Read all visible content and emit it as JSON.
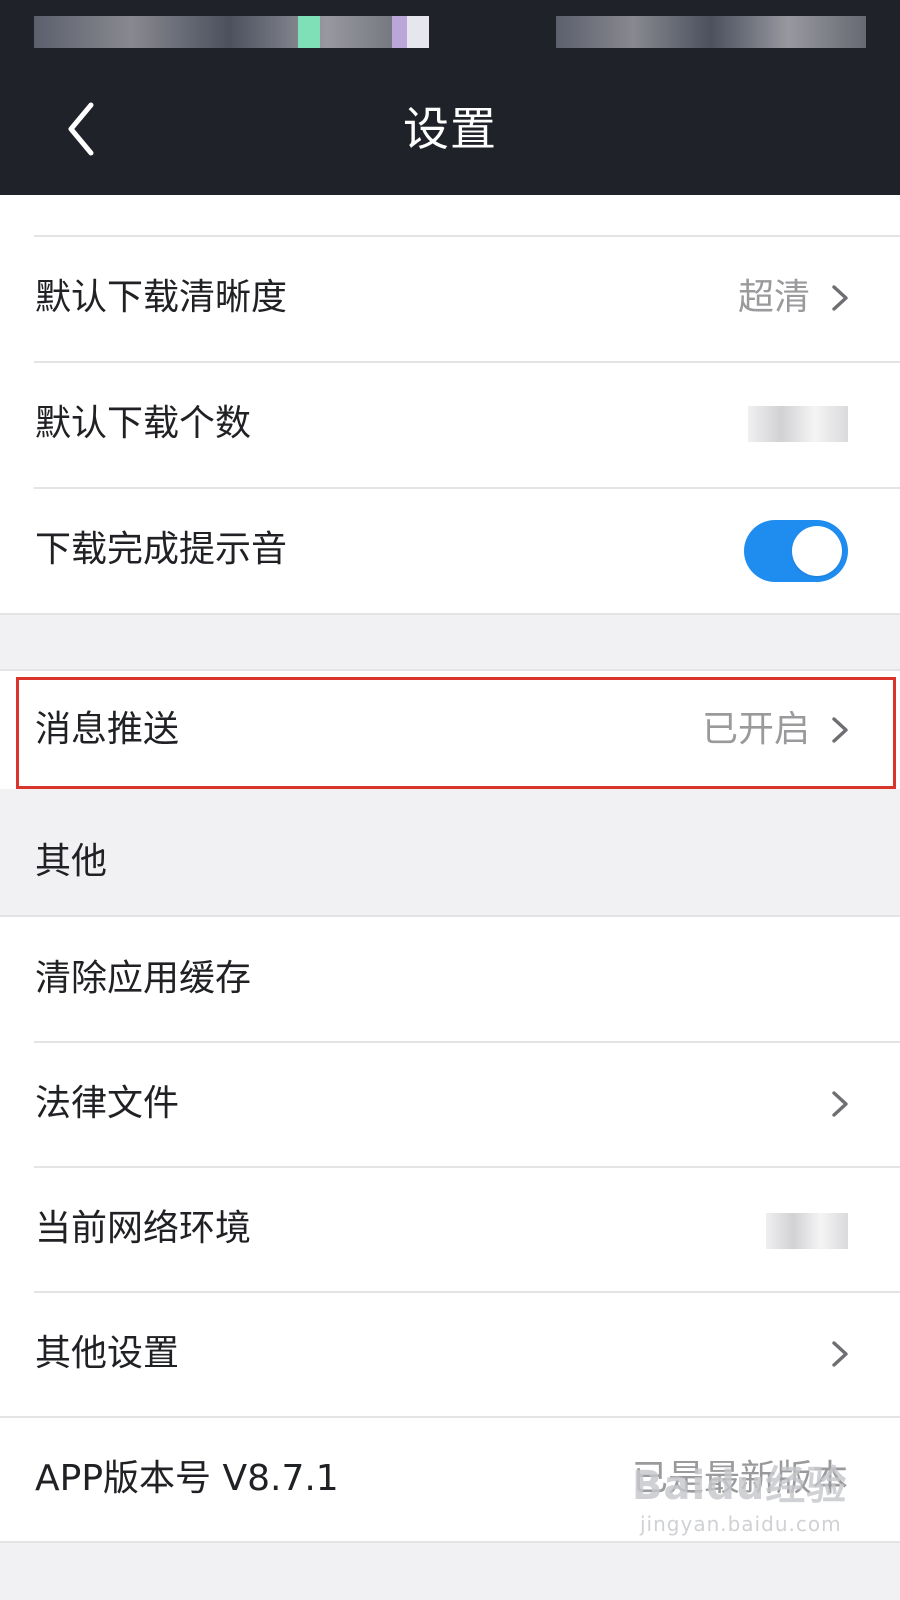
{
  "header": {
    "title": "设置"
  },
  "settings": {
    "download_quality": {
      "label": "默认下载清晰度",
      "value": "超清"
    },
    "download_count": {
      "label": "默认下载个数"
    },
    "download_sound": {
      "label": "下载完成提示音",
      "enabled": true
    },
    "push": {
      "label": "消息推送",
      "value": "已开启"
    }
  },
  "other": {
    "section_title": "其他",
    "clear_cache": {
      "label": "清除应用缓存"
    },
    "legal": {
      "label": "法律文件"
    },
    "network": {
      "label": "当前网络环境"
    },
    "other_settings": {
      "label": "其他设置"
    },
    "version": {
      "label": "APP版本号 V8.7.1",
      "value": "已是最新版本"
    }
  },
  "watermark": {
    "brand": "Baidu经验",
    "url": "jingyan.baidu.com"
  },
  "colors": {
    "header_background": "#1f2229",
    "toggle_on": "#1f8df0",
    "highlight": "#d9352b",
    "page_background": "#f1f1f3"
  },
  "icons": {
    "back": "chevron-left-icon",
    "chevron": "chevron-right-icon"
  }
}
